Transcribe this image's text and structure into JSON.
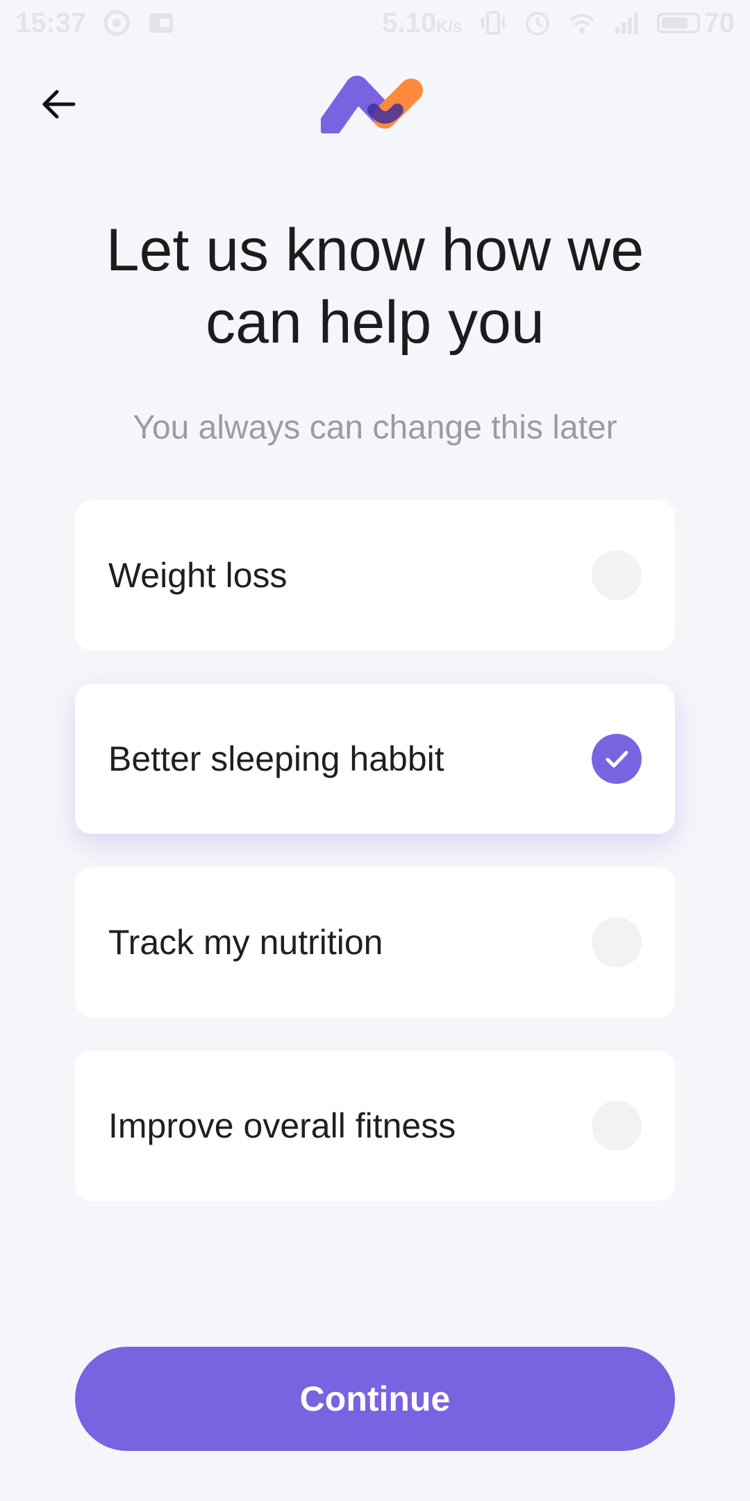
{
  "status_bar": {
    "time": "15:37",
    "network_speed": "5.10",
    "network_unit": "K/s",
    "battery_level": "70",
    "icons": [
      "notification-icon",
      "image-icon",
      "vibrate-icon",
      "alarm-icon",
      "wifi-icon",
      "signal-icon",
      "battery-icon"
    ]
  },
  "header": {
    "back_icon": "arrow-left-icon",
    "logo": "app-logo"
  },
  "main": {
    "title_line1": "Let us know how we",
    "title_line2": "can help you",
    "subtitle": "You always can change this later"
  },
  "options": [
    {
      "label": "Weight loss",
      "selected": false
    },
    {
      "label": "Better sleeping habbit",
      "selected": true
    },
    {
      "label": "Track my nutrition",
      "selected": false
    },
    {
      "label": "Improve overall fitness",
      "selected": false
    }
  ],
  "footer": {
    "continue_label": "Continue"
  },
  "colors": {
    "accent": "#7a63e0",
    "logo_orange": "#ff8a3d",
    "background": "#f4f6fa",
    "card": "#ffffff",
    "unchecked_radio": "#f1f2f4"
  }
}
